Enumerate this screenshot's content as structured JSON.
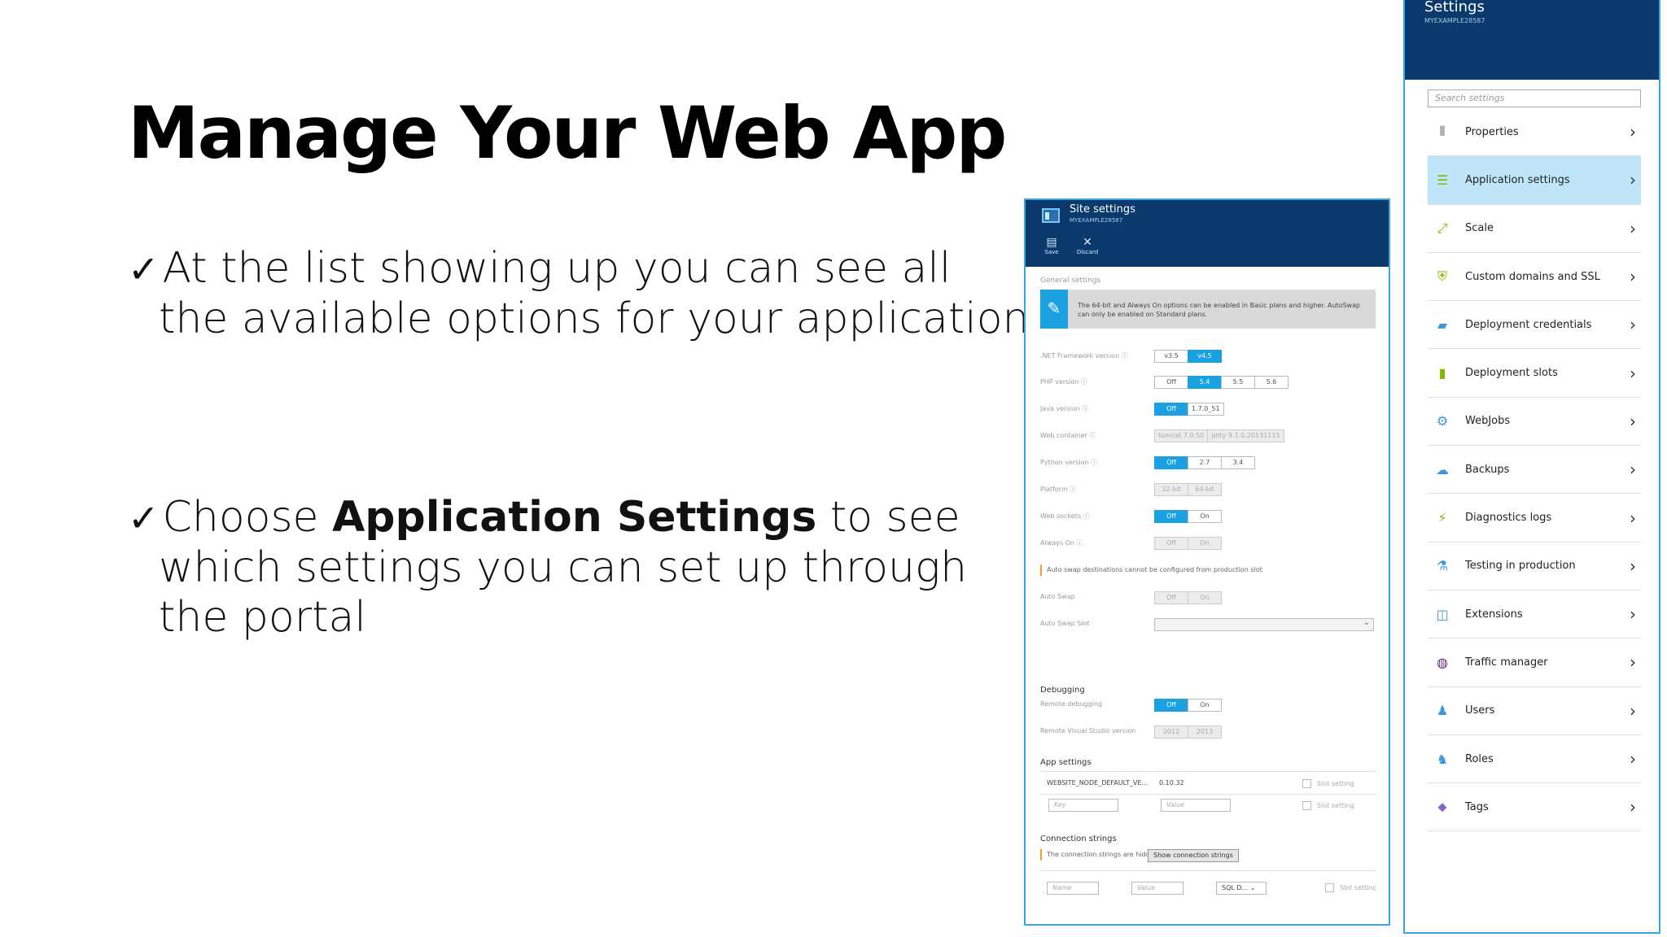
{
  "slide": {
    "title": "Manage Your Web App",
    "bullet1": {
      "check": "✓",
      "line1": "At the list showing up you can see all",
      "line2": "the available options for your application"
    },
    "bullet2": {
      "check": "✓",
      "pre": "Choose ",
      "bold": "Application Settings",
      "post": " to see",
      "line2": "which settings you can set up through",
      "line3": "the portal"
    }
  },
  "site_settings": {
    "title": "Site settings",
    "subtitle": "MYEXAMPLE28587",
    "commands": {
      "save": "Save",
      "discard": "Discard"
    },
    "general_label": "General settings",
    "info_text": "The 64-bit and Always On options can be enabled in Basic plans and higher. AutoSwap can only be enabled on Standard plans.",
    "rows": {
      "net": {
        "label": ".NET Framework version ⓘ",
        "options": [
          "v3.5",
          "v4.5"
        ]
      },
      "php": {
        "label": "PHP version ⓘ",
        "options": [
          "Off",
          "5.4",
          "5.5",
          "5.6"
        ]
      },
      "java": {
        "label": "Java version ⓘ",
        "options": [
          "Off",
          "1.7.0_51"
        ]
      },
      "web_container": {
        "label": "Web container ⓘ",
        "options": [
          "tomcat 7.0.50",
          "jetty 9.1.0.20131115"
        ]
      },
      "python": {
        "label": "Python version ⓘ",
        "options": [
          "Off",
          "2.7",
          "3.4"
        ]
      },
      "platform": {
        "label": "Platform ⓘ",
        "options": [
          "32-bit",
          "64-bit"
        ]
      },
      "web_sockets": {
        "label": "Web sockets ⓘ",
        "options": [
          "Off",
          "On"
        ]
      },
      "always_on": {
        "label": "Always On ⓘ",
        "options": [
          "Off",
          "On"
        ]
      }
    },
    "autoswap_warning": "Auto swap destinations cannot be configured from production slot",
    "auto_swap": {
      "label": "Auto Swap",
      "options": [
        "Off",
        "On"
      ]
    },
    "auto_swap_slot_label": "Auto Swap Slot",
    "debugging": {
      "heading": "Debugging",
      "remote_label": "Remote debugging",
      "remote_options": [
        "Off",
        "On"
      ],
      "vs_label": "Remote Visual Studio version",
      "vs_options": [
        "2012",
        "2013"
      ]
    },
    "app_settings": {
      "heading": "App settings",
      "key": "WEBSITE_NODE_DEFAULT_VE...",
      "value": "0.10.32",
      "slot_setting": "Slot setting",
      "key_placeholder": "Key",
      "value_placeholder": "Value"
    },
    "connection_strings": {
      "heading": "Connection strings",
      "hidden_text": "The connection strings are hidden",
      "show_button": "Show connection strings",
      "name_placeholder": "Name",
      "value_placeholder": "Value",
      "type": "SQL D...",
      "slot_setting": "Slot settinç"
    }
  },
  "settings": {
    "title": "Settings",
    "subtitle": "MYEXAMPLE28587",
    "search_placeholder": "Search settings",
    "items": [
      {
        "label": "Properties",
        "icon": "properties-icon",
        "color": "#5a6b7d"
      },
      {
        "label": "Application settings",
        "icon": "app-settings-icon",
        "color": "#7fba00"
      },
      {
        "label": "Scale",
        "icon": "scale-icon",
        "color": "#7fba00"
      },
      {
        "label": "Custom domains and SSL",
        "icon": "shield-icon",
        "color": "#7fba00"
      },
      {
        "label": "Deployment credentials",
        "icon": "credentials-icon",
        "color": "#3a96dd"
      },
      {
        "label": "Deployment slots",
        "icon": "slots-icon",
        "color": "#7fba00"
      },
      {
        "label": "WebJobs",
        "icon": "webjobs-icon",
        "color": "#3a96dd"
      },
      {
        "label": "Backups",
        "icon": "cloud-icon",
        "color": "#3a96dd"
      },
      {
        "label": "Diagnostics logs",
        "icon": "diagnostics-icon",
        "color": "#7fba00"
      },
      {
        "label": "Testing in production",
        "icon": "testing-icon",
        "color": "#3a96dd"
      },
      {
        "label": "Extensions",
        "icon": "extensions-icon",
        "color": "#3a96dd"
      },
      {
        "label": "Traffic manager",
        "icon": "globe-icon",
        "color": "#68217a"
      },
      {
        "label": "Users",
        "icon": "users-icon",
        "color": "#3a96dd"
      },
      {
        "label": "Roles",
        "icon": "roles-icon",
        "color": "#3a96dd"
      },
      {
        "label": "Tags",
        "icon": "tag-icon",
        "color": "#8661c5"
      }
    ],
    "selected_index": 1
  },
  "colors": {
    "header": "#0a3a6b",
    "accent": "#1ba1e2",
    "selected": "#bfe6f8",
    "border": "#3aa7de"
  }
}
